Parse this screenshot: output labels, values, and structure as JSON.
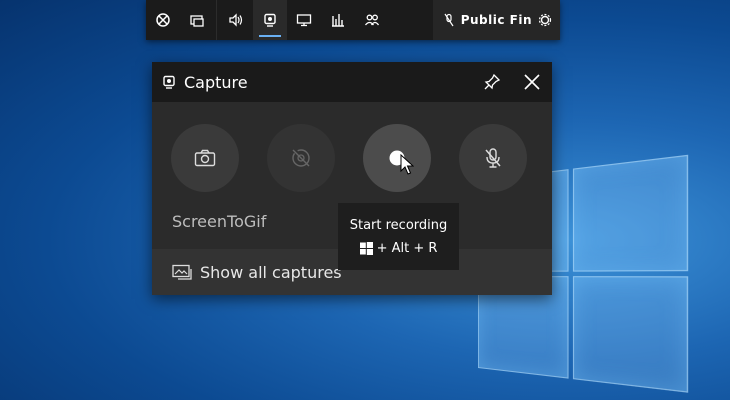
{
  "gamebar": {
    "items": [
      {
        "icon": "xbox-icon"
      },
      {
        "icon": "performance-icon"
      },
      {
        "icon": "audio-icon"
      },
      {
        "icon": "capture-icon"
      },
      {
        "icon": "display-icon"
      },
      {
        "icon": "resources-icon"
      },
      {
        "icon": "social-icon"
      }
    ],
    "active_index": 3,
    "time": "Public Fin"
  },
  "capture": {
    "title": "Capture",
    "app_name": "ScreenToGif",
    "show_all_label": "Show all captures",
    "buttons": [
      {
        "name": "screenshot-button",
        "icon": "camera-icon",
        "state": "normal"
      },
      {
        "name": "record-last-button",
        "icon": "record-last-30s-icon",
        "state": "disabled"
      },
      {
        "name": "start-recording-button",
        "icon": "record-icon",
        "state": "hover"
      },
      {
        "name": "microphone-button",
        "icon": "microphone-off-icon",
        "state": "normal"
      }
    ]
  },
  "tooltip": {
    "title": "Start recording",
    "shortcut": "+ Alt + R"
  },
  "colors": {
    "accent": "#6ab0f3",
    "panel": "#2b2b2b",
    "header": "#1a1a1a"
  }
}
